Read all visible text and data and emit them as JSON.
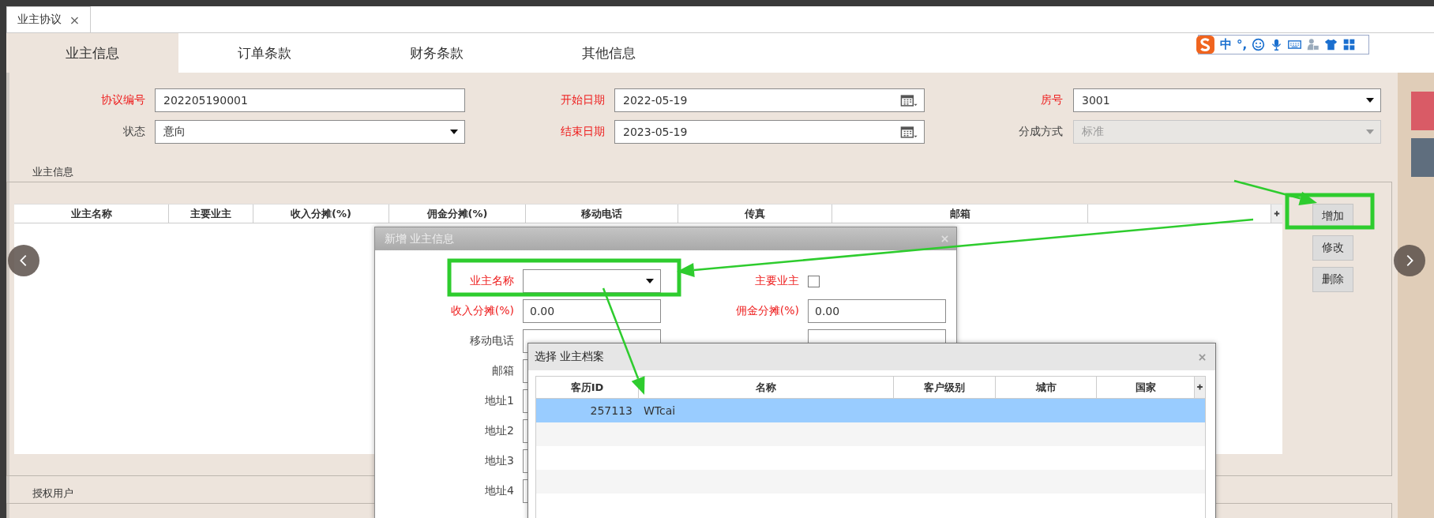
{
  "document_tab": {
    "label": "业主协议",
    "close": "×"
  },
  "tabs": [
    {
      "label": "业主信息",
      "selected": true
    },
    {
      "label": "订单条款",
      "selected": false
    },
    {
      "label": "财务条款",
      "selected": false
    },
    {
      "label": "其他信息",
      "selected": false
    }
  ],
  "ime_toolbar": {
    "mode": "中",
    "punctuation": "°,"
  },
  "form": [
    {
      "label": "协议编号",
      "kind": "text",
      "value": "202205190001",
      "required": true,
      "disabled": false
    },
    {
      "label": "开始日期",
      "kind": "date",
      "value": "2022-05-19",
      "required": true,
      "disabled": false
    },
    {
      "label": "房号",
      "kind": "select",
      "value": "3001",
      "required": true,
      "disabled": false
    },
    {
      "label": "状态",
      "kind": "select",
      "value": "意向",
      "required": false,
      "disabled": false
    },
    {
      "label": "结束日期",
      "kind": "date",
      "value": "2023-05-19",
      "required": true,
      "disabled": false
    },
    {
      "label": "分成方式",
      "kind": "select",
      "value": "标准",
      "required": false,
      "disabled": true
    }
  ],
  "owner_section": {
    "title": "业主信息",
    "columns": [
      "业主名称",
      "主要业主",
      "收入分摊(%)",
      "佣金分摊(%)",
      "移动电话",
      "传真",
      "邮箱"
    ],
    "buttons": [
      "增加",
      "修改",
      "删除"
    ]
  },
  "auth_section": {
    "title": "授权用户"
  },
  "add_dialog": {
    "title": "新增 业主信息",
    "fields": [
      {
        "label": "业主名称",
        "kind": "select",
        "required": true
      },
      {
        "label": "主要业主",
        "kind": "checkbox",
        "required": true,
        "checked": false
      },
      {
        "label": "收入分摊(%)",
        "kind": "text",
        "value": "0.00",
        "required": true
      },
      {
        "label": "佣金分摊(%)",
        "kind": "text",
        "value": "0.00",
        "required": true
      },
      {
        "label": "移动电话",
        "kind": "text",
        "required": false
      },
      {
        "kind": "text"
      },
      {
        "label": "邮箱",
        "kind": "wide",
        "required": false
      },
      {
        "label": "地址1",
        "kind": "wide",
        "required": false
      },
      {
        "label": "地址2",
        "kind": "wide",
        "required": false
      },
      {
        "label": "地址3",
        "kind": "wide",
        "required": false
      },
      {
        "label": "地址4",
        "kind": "wide",
        "required": false
      }
    ]
  },
  "select_dialog": {
    "title": "选择 业主档案",
    "columns": [
      "客历ID",
      "名称",
      "客户级别",
      "城市",
      "国家"
    ],
    "rows": [
      {
        "id": "257113",
        "name": "WTcai",
        "selected": true
      }
    ]
  }
}
